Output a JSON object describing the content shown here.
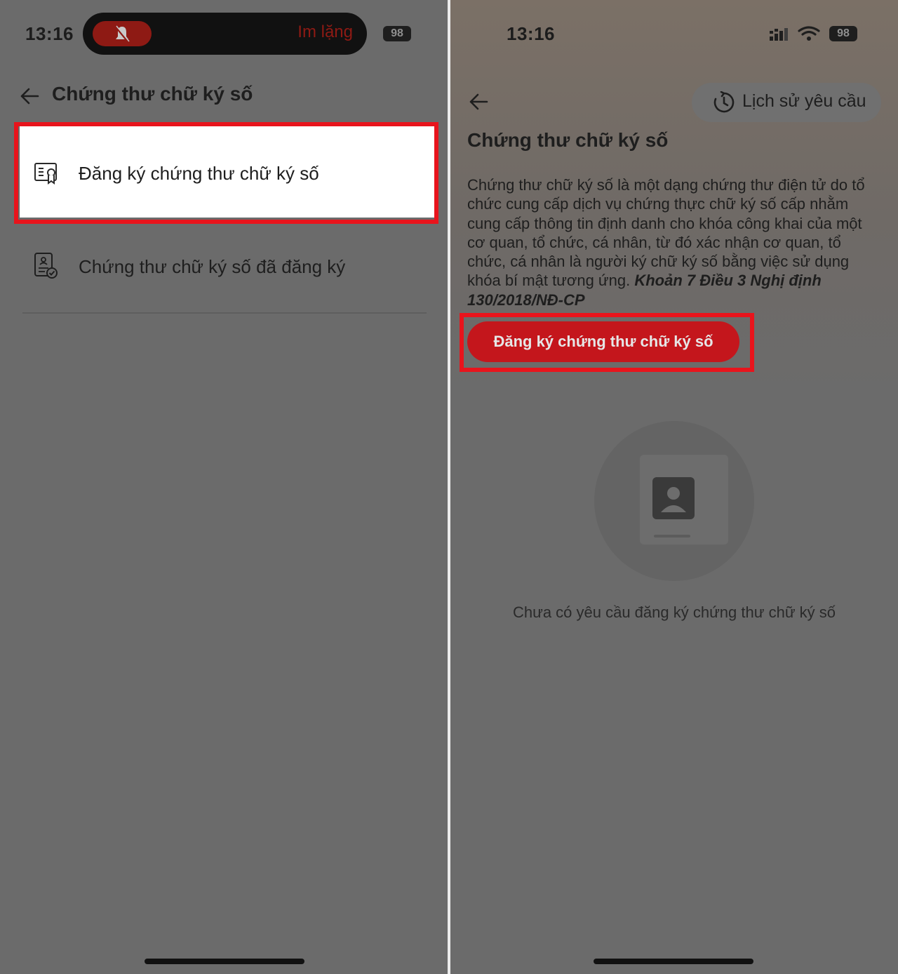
{
  "left_screen": {
    "status_bar": {
      "time": "13:16",
      "silent_label": "Im lặng",
      "battery": "98"
    },
    "header": {
      "title": "Chứng thư chữ ký số"
    },
    "menu": [
      {
        "label": "Đăng ký chứng thư chữ ký số",
        "icon": "certificate-icon",
        "highlighted": true
      },
      {
        "label": "Chứng thư chữ ký số đã đăng ký",
        "icon": "registered-document-icon",
        "highlighted": false
      }
    ]
  },
  "right_screen": {
    "status_bar": {
      "time": "13:16",
      "battery": "98"
    },
    "history_button": {
      "label": "Lịch sử yêu cầu",
      "icon": "history-icon"
    },
    "title": "Chứng thư chữ ký số",
    "description": "Chứng thư chữ ký số là một dạng chứng thư điện tử do tổ chức cung cấp dịch vụ chứng thực chữ ký số cấp nhằm cung cấp thông tin định danh cho khóa công khai của một cơ quan, tổ chức, cá nhân, từ đó xác nhận cơ quan, tổ chức, cá nhân là người ký chữ ký số bằng việc sử dụng khóa bí mật tương ứng.",
    "legal_reference": "Khoản 7 Điều 3 Nghị định 130/2018/NĐ-CP",
    "register_button": {
      "label": "Đăng ký chứng thư chữ ký số"
    },
    "empty_state": {
      "message": "Chưa có yêu cầu đăng ký chứng thư chữ ký số"
    }
  },
  "colors": {
    "highlight_border": "#e8141c",
    "primary_button": "#c4161c",
    "overlay_background": "#6b6b6b"
  }
}
